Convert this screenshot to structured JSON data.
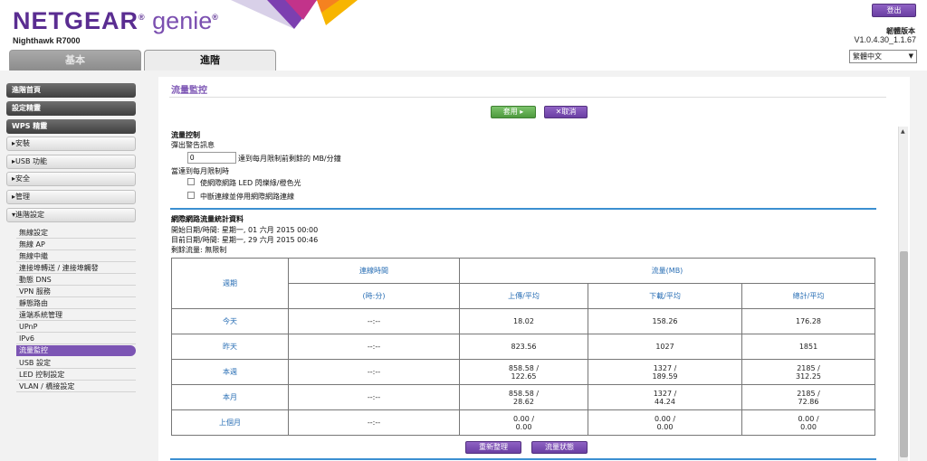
{
  "header": {
    "brand_main": "NETGEAR",
    "brand_reg": "®",
    "brand_sub": " genie",
    "brand_tm": "®",
    "model": "Nighthawk R7000",
    "logout_label": "登出",
    "firmware_label": "韌體版本",
    "firmware_version": "V1.0.4.30_1.1.67",
    "language": "繁體中文",
    "tabs": {
      "basic": "基本",
      "advanced": "進階"
    }
  },
  "sidebar": {
    "home": "進階首頁",
    "setup_wizard": "設定精靈",
    "wps_wizard": "WPS 精靈",
    "sections": [
      "▸安裝",
      "▸USB 功能",
      "▸安全",
      "▸管理",
      "▾進階設定"
    ],
    "items": [
      "無線設定",
      "無線 AP",
      "無線中繼",
      "連接埠轉送 / 連接埠觸發",
      "動態 DNS",
      "VPN 服務",
      "靜態路由",
      "遠端系統管理",
      "UPnP",
      "IPv6",
      "流量監控",
      "USB 設定",
      "LED 控制設定",
      "VLAN / 橋接設定"
    ],
    "active_item": "流量監控"
  },
  "main": {
    "title": "流量監控",
    "apply_label": "套用 ▸",
    "cancel_label": "✕取消",
    "traffic_control": {
      "heading": "流量控制",
      "popup_label": "彈出警告訊息",
      "input_value": "0",
      "input_suffix": "達到每月限制前剩餘的 MB/分鐘",
      "when_reached": "當達到每月限制時",
      "option_led": "使網際網路 LED 閃爍綠/橙色光",
      "option_disconnect": "中斷連線並停用網際網路連線"
    },
    "stats": {
      "heading": "網際網路流量統計資料",
      "start_time": "開始日期/時間: 星期一, 01 六月 2015 00:00",
      "current_time": "目前日期/時間: 星期一, 29 六月 2015 00:46",
      "remaining": "剩餘流量: 無限制"
    },
    "table": {
      "col_period": "週期",
      "col_connect": "連線時間",
      "col_connect_unit": "(時:分)",
      "col_traffic": "流量(MB)",
      "col_upload": "上傳/平均",
      "col_download": "下載/平均",
      "col_total": "總計/平均",
      "rows": [
        {
          "period": "今天",
          "time": "--:--",
          "up1": "18.02",
          "up2": "",
          "down1": "158.26",
          "down2": "",
          "total1": "176.28",
          "total2": ""
        },
        {
          "period": "昨天",
          "time": "--:--",
          "up1": "823.56",
          "up2": "",
          "down1": "1027",
          "down2": "",
          "total1": "1851",
          "total2": ""
        },
        {
          "period": "本週",
          "time": "--:--",
          "up1": "858.58 /",
          "up2": "122.65",
          "down1": "1327 /",
          "down2": "189.59",
          "total1": "2185 /",
          "total2": "312.25"
        },
        {
          "period": "本月",
          "time": "--:--",
          "up1": "858.58 /",
          "up2": "28.62",
          "down1": "1327 /",
          "down2": "44.24",
          "total1": "2185 /",
          "total2": "72.86"
        },
        {
          "period": "上個月",
          "time": "--:--",
          "up1": "0.00 /",
          "up2": "0.00",
          "down1": "0.00 /",
          "down2": "0.00",
          "total1": "0.00 /",
          "total2": "0.00"
        }
      ]
    },
    "restart_label": "重新整理",
    "status_label": "流量狀態"
  },
  "colors": {
    "accent": "#7c55b4",
    "apply": "#5fae4d",
    "rule": "#3b8fd1"
  }
}
